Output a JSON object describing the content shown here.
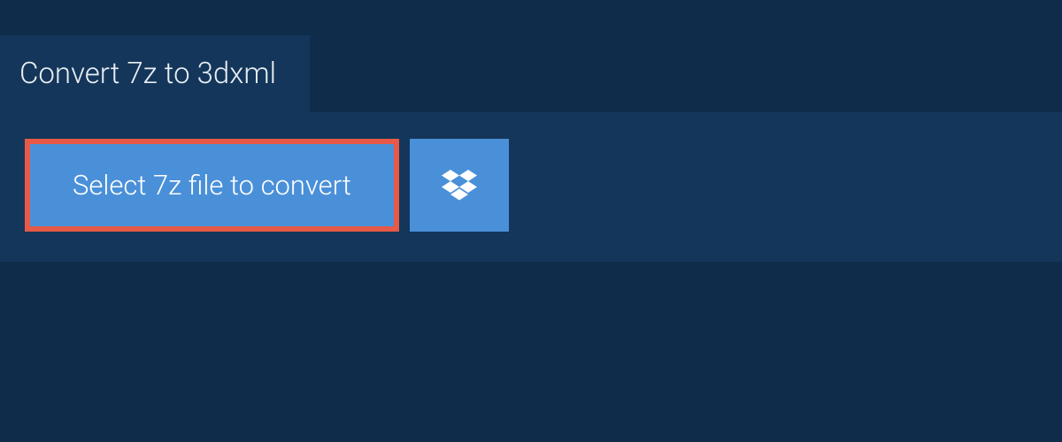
{
  "header": {
    "title": "Convert 7z to 3dxml"
  },
  "main": {
    "select_button_label": "Select 7z file to convert"
  }
}
